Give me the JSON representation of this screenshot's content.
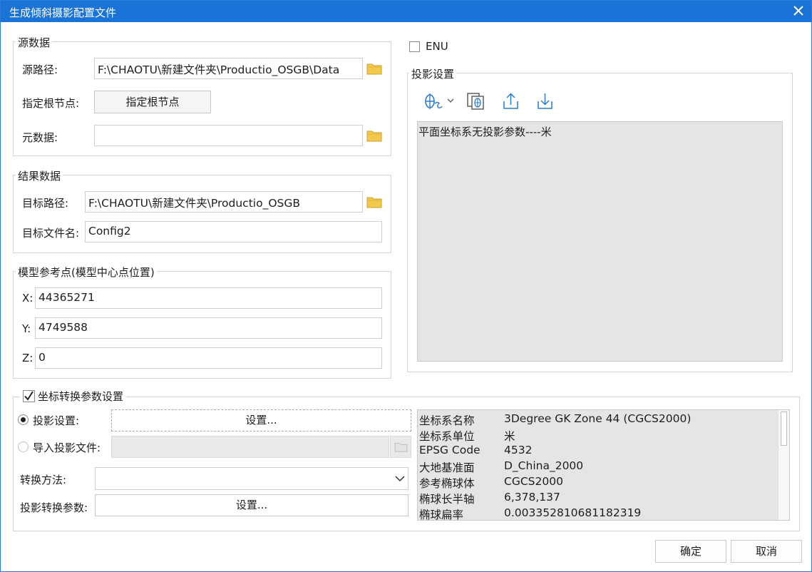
{
  "window": {
    "title": "生成倾斜摄影配置文件"
  },
  "source": {
    "legend": "源数据",
    "path_label": "源路径:",
    "path_value": "F:\\CHAOTU\\新建文件夹\\Productio_OSGB\\Data",
    "root_label": "指定根节点:",
    "root_button": "指定根节点",
    "meta_label": "元数据:",
    "meta_value": ""
  },
  "result": {
    "legend": "结果数据",
    "path_label": "目标路径:",
    "path_value": "F:\\CHAOTU\\新建文件夹\\Productio_OSGB",
    "file_label": "目标文件名:",
    "file_value": "Config2"
  },
  "refpoint": {
    "legend": "模型参考点(模型中心点位置)",
    "x_label": "X:",
    "x_value": "44365271",
    "y_label": "Y:",
    "y_value": "4749588",
    "z_label": "Z:",
    "z_value": "0"
  },
  "enu": {
    "label": "ENU",
    "checked": false
  },
  "projection": {
    "legend": "投影设置",
    "text": "平面坐标系无投影参数----米"
  },
  "transform": {
    "legend": "坐标转换参数设置",
    "checked": true,
    "proj_setting_label": "投影设置:",
    "proj_setting_button": "设置...",
    "import_label": "导入投影文件:",
    "import_value": "",
    "method_label": "转换方法:",
    "method_value": "",
    "params_label": "投影转换参数:",
    "params_button": "设置...",
    "info": [
      {
        "k": "坐标系名称",
        "v": "3Degree GK Zone 44     (CGCS2000)"
      },
      {
        "k": "坐标系单位",
        "v": "米"
      },
      {
        "k": "EPSG Code",
        "v": "4532"
      },
      {
        "k": "大地基准面",
        "v": "D_China_2000"
      },
      {
        "k": "参考椭球体",
        "v": "CGCS2000"
      },
      {
        "k": "椭球长半轴",
        "v": "6,378,137"
      },
      {
        "k": "椭球扁率",
        "v": "0.003352810681182319"
      }
    ]
  },
  "footer": {
    "ok": "确定",
    "cancel": "取消"
  },
  "colors": {
    "titlebar": "#1a74d8",
    "accent_icon": "#2a7bd0",
    "folder": "#f2c94c"
  }
}
